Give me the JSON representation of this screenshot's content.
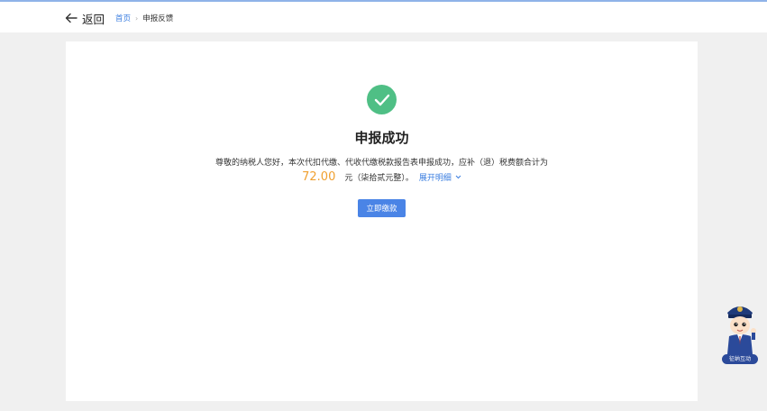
{
  "header": {
    "back_label": "返回",
    "breadcrumb": {
      "home": "首页",
      "separator": "›",
      "current": "申报反馈"
    }
  },
  "result": {
    "icon": "check-circle-icon",
    "title": "申报成功",
    "description": "尊敬的纳税人您好，本次代扣代缴、代收代缴税款报告表申报成功，应补（退）税费额合计为",
    "amount": "72.00",
    "amount_text": "元（柒拾贰元整）。",
    "expand_label": "展开明细",
    "pay_button_label": "立即缴款"
  },
  "assistant": {
    "icon": "tax-officer-mascot-icon",
    "label": "征纳互动"
  },
  "colors": {
    "accent": "#3c7fe0",
    "success": "#4fbf85",
    "amount": "#f0a030",
    "button": "#4a84e6"
  }
}
